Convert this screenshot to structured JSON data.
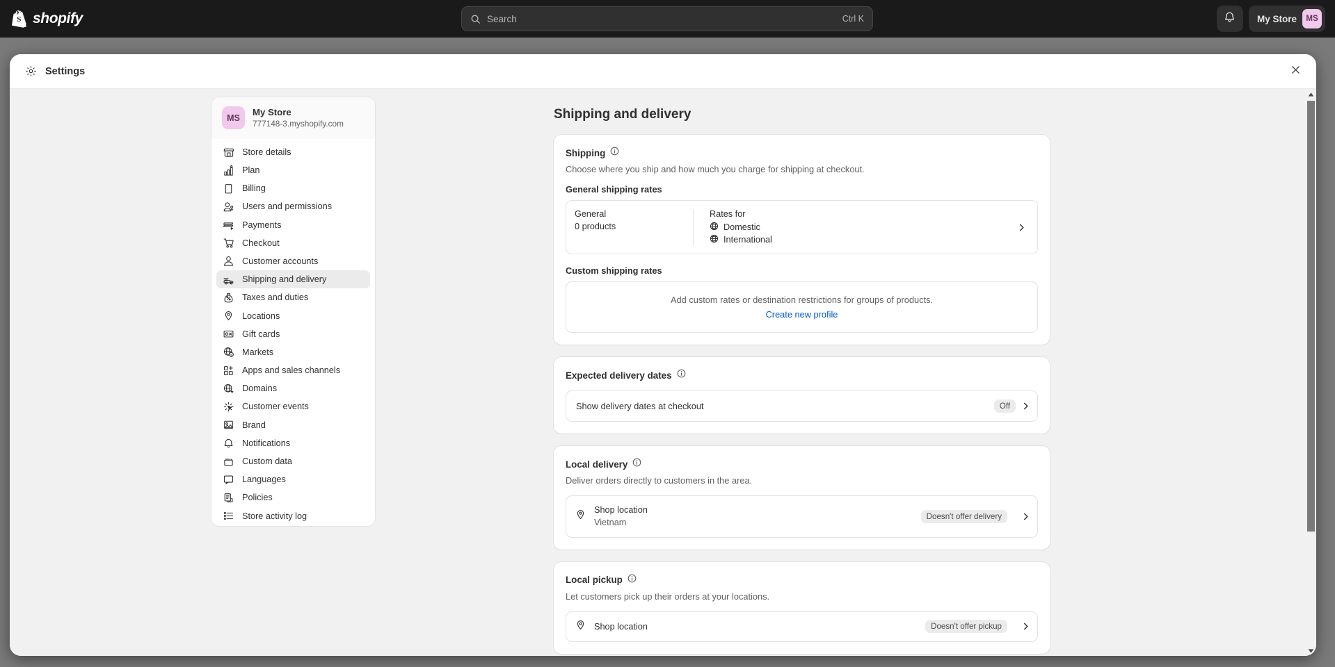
{
  "topbar": {
    "logo_text": "shopify",
    "logo_icon": "shopify-bag-icon",
    "search": {
      "placeholder": "Search",
      "shortcut": "Ctrl K",
      "icon": "search-icon"
    },
    "notifications_icon": "bell-icon",
    "store_button": {
      "label": "My Store",
      "initials": "MS"
    }
  },
  "modal": {
    "title": "Settings",
    "title_icon": "gear-icon",
    "close_icon": "close-icon"
  },
  "sidebar": {
    "store": {
      "initials": "MS",
      "name": "My Store",
      "url": "777148-3.myshopify.com"
    },
    "items": [
      {
        "label": "Store details",
        "icon": "store-icon",
        "active": false
      },
      {
        "label": "Plan",
        "icon": "plan-icon",
        "active": false
      },
      {
        "label": "Billing",
        "icon": "billing-icon",
        "active": false
      },
      {
        "label": "Users and permissions",
        "icon": "users-icon",
        "active": false
      },
      {
        "label": "Payments",
        "icon": "payments-icon",
        "active": false
      },
      {
        "label": "Checkout",
        "icon": "cart-icon",
        "active": false
      },
      {
        "label": "Customer accounts",
        "icon": "person-icon",
        "active": false
      },
      {
        "label": "Shipping and delivery",
        "icon": "delivery-truck-icon",
        "active": true
      },
      {
        "label": "Taxes and duties",
        "icon": "taxes-icon",
        "active": false
      },
      {
        "label": "Locations",
        "icon": "location-pin-icon",
        "active": false
      },
      {
        "label": "Gift cards",
        "icon": "gift-card-icon",
        "active": false
      },
      {
        "label": "Markets",
        "icon": "markets-globe-icon",
        "active": false
      },
      {
        "label": "Apps and sales channels",
        "icon": "apps-icon",
        "active": false
      },
      {
        "label": "Domains",
        "icon": "domain-globe-icon",
        "active": false
      },
      {
        "label": "Customer events",
        "icon": "customer-events-icon",
        "active": false
      },
      {
        "label": "Brand",
        "icon": "brand-icon",
        "active": false
      },
      {
        "label": "Notifications",
        "icon": "notifications-bell-icon",
        "active": false
      },
      {
        "label": "Custom data",
        "icon": "custom-data-icon",
        "active": false
      },
      {
        "label": "Languages",
        "icon": "languages-icon",
        "active": false
      },
      {
        "label": "Policies",
        "icon": "policies-icon",
        "active": false
      },
      {
        "label": "Store activity log",
        "icon": "activity-log-icon",
        "active": false
      }
    ]
  },
  "main": {
    "page_title": "Shipping and delivery",
    "shipping": {
      "title": "Shipping",
      "info_icon": "info-icon",
      "description": "Choose where you ship and how much you charge for shipping at checkout.",
      "general_rates_label": "General shipping rates",
      "general_profile": {
        "name": "General",
        "products": "0 products",
        "rates_for_label": "Rates for",
        "rates": [
          "Domestic",
          "International"
        ],
        "chevron": "chevron-right-icon"
      },
      "custom_rates_label": "Custom shipping rates",
      "custom_empty_text": "Add custom rates or destination restrictions for groups of products.",
      "custom_empty_link": "Create new profile"
    },
    "expected_delivery": {
      "title": "Expected delivery dates",
      "info_icon": "info-icon",
      "row_label": "Show delivery dates at checkout",
      "row_badge": "Off",
      "chevron": "chevron-right-icon"
    },
    "local_delivery": {
      "title": "Local delivery",
      "info_icon": "info-icon",
      "description": "Deliver orders directly to customers in the area.",
      "location": {
        "icon": "location-pin-icon",
        "name": "Shop location",
        "sub": "Vietnam",
        "badge": "Doesn't offer delivery",
        "chevron": "chevron-right-icon"
      }
    },
    "local_pickup": {
      "title": "Local pickup",
      "info_icon": "info-icon",
      "description": "Let customers pick up their orders at your locations.",
      "location": {
        "icon": "location-pin-icon",
        "name": "Shop location",
        "badge": "Doesn't offer pickup",
        "chevron": "chevron-right-icon"
      }
    }
  },
  "scrollbar": {
    "up_icon": "scroll-up-arrow-icon",
    "down_icon": "scroll-down-arrow-icon"
  },
  "colors": {
    "accent_link": "#005bd3",
    "avatar_bg": "#f2c8ed",
    "topbar_bg": "#1a1a1a",
    "page_bg": "#f1f1f1"
  }
}
